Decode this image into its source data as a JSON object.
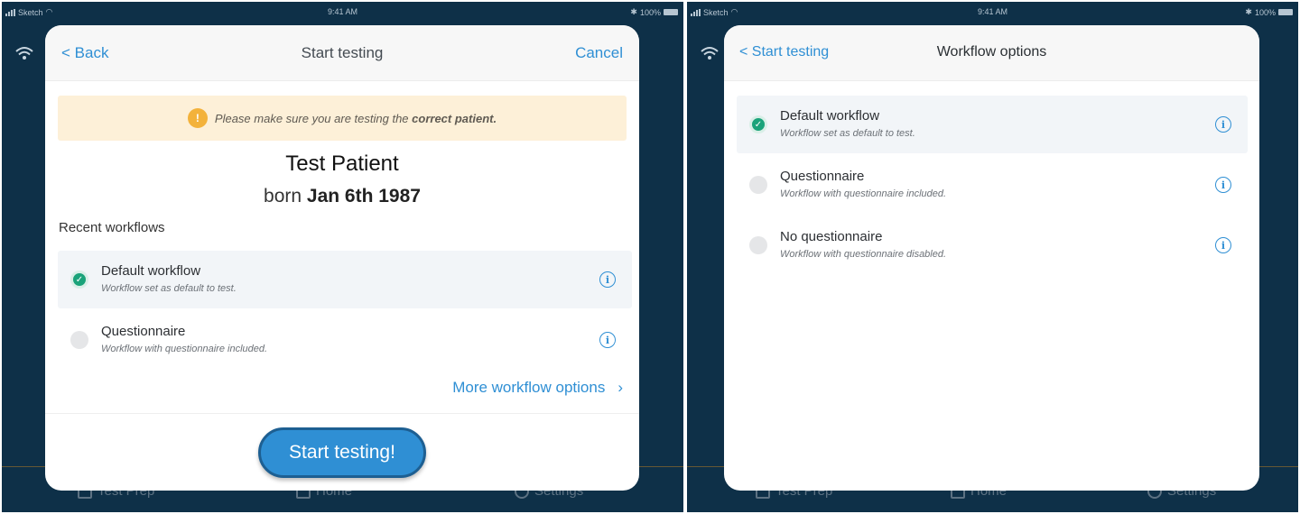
{
  "status_bar": {
    "carrier": "Sketch",
    "time": "9:41 AM",
    "battery": "100%"
  },
  "tab_bar": {
    "tabs": [
      "Test Prep",
      "Home",
      "Settings"
    ]
  },
  "left_screen": {
    "nav": {
      "back_label": "< Back",
      "title": "Start testing",
      "cancel_label": "Cancel"
    },
    "warning": {
      "icon": "warning-icon",
      "text_prefix": "Please make sure you are testing the",
      "text_bold": "correct patient."
    },
    "patient": {
      "name": "Test Patient",
      "born_prefix": "born",
      "born_date": "Jan 6th 1987"
    },
    "section_label": "Recent workflows",
    "workflows": [
      {
        "title": "Default workflow",
        "subtitle": "Workflow set as default to test.",
        "selected": true
      },
      {
        "title": "Questionnaire",
        "subtitle": "Workflow with questionnaire included.",
        "selected": false
      }
    ],
    "more_options_label": "More workflow options",
    "start_button_label": "Start testing!"
  },
  "right_screen": {
    "nav": {
      "back_label": "< Start testing",
      "title": "Workflow options"
    },
    "workflows": [
      {
        "title": "Default workflow",
        "subtitle": "Workflow set as default to test.",
        "selected": true
      },
      {
        "title": "Questionnaire",
        "subtitle": "Workflow with questionnaire included.",
        "selected": false
      },
      {
        "title": "No questionnaire",
        "subtitle": "Workflow with questionnaire disabled.",
        "selected": false
      }
    ]
  },
  "colors": {
    "accent": "#2f8fd4",
    "background": "#0e3048",
    "selected_check": "#1aa37a",
    "warning_bg": "#fdf0d8",
    "warning_icon": "#f3b23b"
  }
}
